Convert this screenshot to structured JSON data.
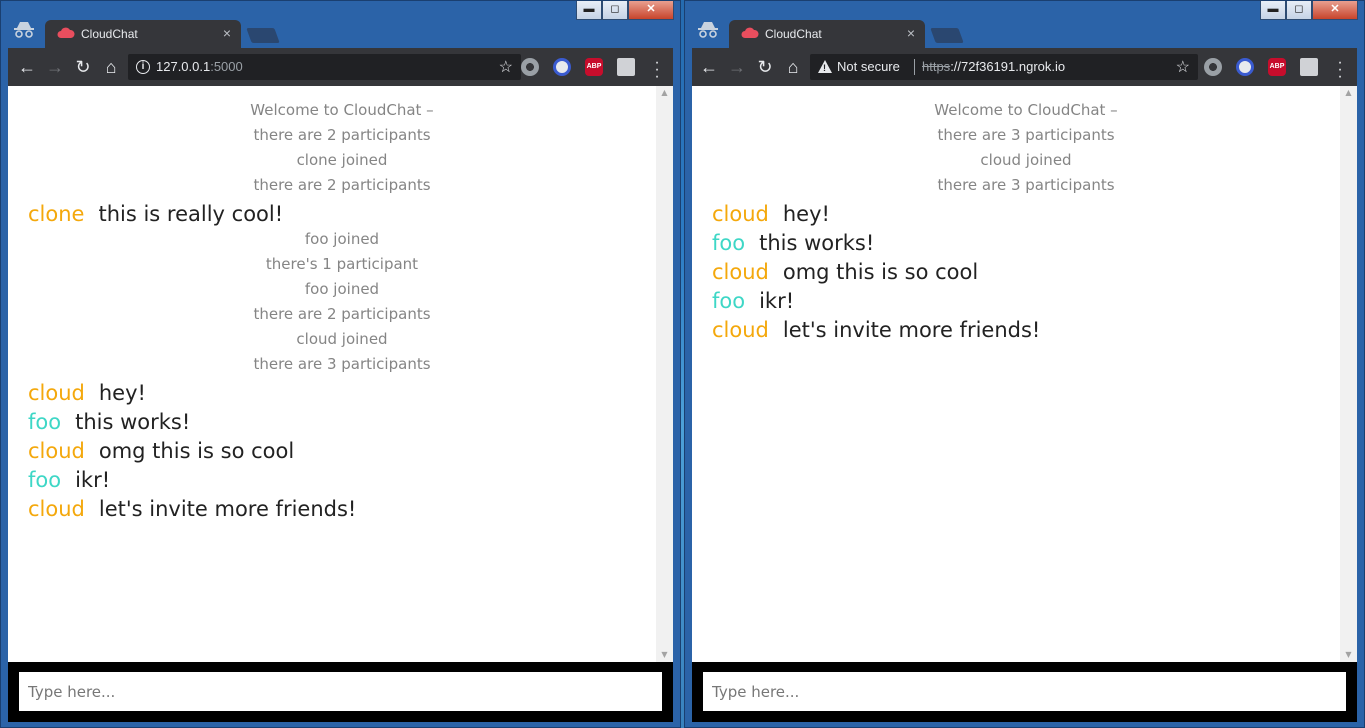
{
  "colors": {
    "cloud": "#f4a80c",
    "clone": "#f4a80c",
    "foo": "#3ed7c6"
  },
  "windows": [
    {
      "tab": {
        "title": "CloudChat",
        "close": "×",
        "favicon": "cloud-icon"
      },
      "window_controls": {
        "minimize": "▬",
        "maximize": "◻",
        "close": "✕"
      },
      "nav": {
        "back": "←",
        "forward": "→",
        "reload": "↻",
        "home": "⌂"
      },
      "omnibox": {
        "host": "127.0.0.1",
        "port": ":5000",
        "star": "☆"
      },
      "extensions": [
        "chrome-extension-icon",
        "noscript-icon",
        "abp-icon",
        "bookmark-manager-icon"
      ],
      "abp_label": "ABP",
      "menu": "⋮",
      "chat": [
        {
          "type": "system",
          "text": "Welcome to CloudChat –"
        },
        {
          "type": "system",
          "text": "there are 2 participants"
        },
        {
          "type": "system",
          "text": "clone joined"
        },
        {
          "type": "system",
          "text": "there are 2 participants"
        },
        {
          "type": "message",
          "user": "clone",
          "text": "this is really cool!"
        },
        {
          "type": "system",
          "text": "foo joined"
        },
        {
          "type": "system",
          "text": "there's 1 participant"
        },
        {
          "type": "system",
          "text": "foo joined"
        },
        {
          "type": "system",
          "text": "there are 2 participants"
        },
        {
          "type": "system",
          "text": "cloud joined"
        },
        {
          "type": "system",
          "text": "there are 3 participants"
        },
        {
          "type": "message",
          "user": "cloud",
          "text": "hey!"
        },
        {
          "type": "message",
          "user": "foo",
          "text": "this works!"
        },
        {
          "type": "message",
          "user": "cloud",
          "text": "omg this is so cool"
        },
        {
          "type": "message",
          "user": "foo",
          "text": "ikr!"
        },
        {
          "type": "message",
          "user": "cloud",
          "text": "let's invite more friends!"
        }
      ],
      "input": {
        "placeholder": "Type here...",
        "value": ""
      }
    },
    {
      "tab": {
        "title": "CloudChat",
        "close": "×",
        "favicon": "cloud-icon"
      },
      "window_controls": {
        "minimize": "▬",
        "maximize": "◻",
        "close": "✕"
      },
      "nav": {
        "back": "←",
        "forward": "→",
        "reload": "↻",
        "home": "⌂"
      },
      "omnibox": {
        "security": "Not secure",
        "scheme": "https",
        "host": "://72f36191.ngrok.io",
        "star": "☆"
      },
      "extensions": [
        "chrome-extension-icon",
        "noscript-icon",
        "abp-icon",
        "bookmark-manager-icon"
      ],
      "abp_label": "ABP",
      "menu": "⋮",
      "chat": [
        {
          "type": "system",
          "text": "Welcome to CloudChat –"
        },
        {
          "type": "system",
          "text": "there are 3 participants"
        },
        {
          "type": "system",
          "text": "cloud joined"
        },
        {
          "type": "system",
          "text": "there are 3 participants"
        },
        {
          "type": "message",
          "user": "cloud",
          "text": "hey!"
        },
        {
          "type": "message",
          "user": "foo",
          "text": "this works!"
        },
        {
          "type": "message",
          "user": "cloud",
          "text": "omg this is so cool"
        },
        {
          "type": "message",
          "user": "foo",
          "text": "ikr!"
        },
        {
          "type": "message",
          "user": "cloud",
          "text": "let's invite more friends!"
        }
      ],
      "input": {
        "placeholder": "Type here...",
        "value": ""
      }
    }
  ]
}
